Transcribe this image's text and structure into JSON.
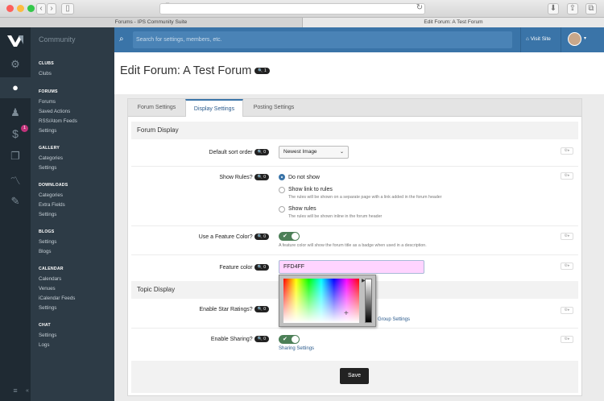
{
  "browser": {
    "tabs": [
      "Forums - IPS Community Suite",
      "Edit Forum: A Test Forum"
    ],
    "traffic_colors": [
      "#fc605c",
      "#fdbc40",
      "#34c84a"
    ]
  },
  "sidebar": {
    "brand": "Community",
    "notification_count": "1",
    "rail_icons": [
      "cogs-icon",
      "comments-icon",
      "user-icon",
      "dollar-icon",
      "copy-icon",
      "chart-icon",
      "brush-icon"
    ],
    "sections": [
      {
        "title": "CLUBS",
        "items": [
          "Clubs"
        ]
      },
      {
        "title": "FORUMS",
        "items": [
          "Forums",
          "Saved Actions",
          "RSS/Atom Feeds",
          "Settings"
        ]
      },
      {
        "title": "GALLERY",
        "items": [
          "Categories",
          "Settings"
        ]
      },
      {
        "title": "DOWNLOADS",
        "items": [
          "Categories",
          "Extra Fields",
          "Settings"
        ]
      },
      {
        "title": "BLOGS",
        "items": [
          "Settings",
          "Blogs"
        ]
      },
      {
        "title": "CALENDAR",
        "items": [
          "Calendars",
          "Venues",
          "iCalendar Feeds",
          "Settings"
        ]
      },
      {
        "title": "CHAT",
        "items": [
          "Settings",
          "Logs"
        ]
      }
    ]
  },
  "header": {
    "search_placeholder": "Search for settings, members, etc.",
    "visit_site": "Visit Site"
  },
  "page": {
    "title": "Edit Forum: A Test Forum",
    "title_badge": "1"
  },
  "tabs": [
    "Forum Settings",
    "Display Settings",
    "Posting Settings"
  ],
  "active_tab": "Display Settings",
  "forum_display": {
    "heading": "Forum Display",
    "sort_order_label": "Default sort order",
    "sort_order_value": "Newest Image",
    "show_rules_label": "Show Rules?",
    "rules_options": [
      {
        "label": "Do not show",
        "desc": ""
      },
      {
        "label": "Show link to rules",
        "desc": "The rules will be shown on a separate page with a link added in the forum header"
      },
      {
        "label": "Show rules",
        "desc": "The rules will be shown inline in the forum header"
      }
    ],
    "feature_color_toggle_label": "Use a Feature Color?",
    "feature_color_desc": "A feature color will show the forum title as a badge when used in a description.",
    "feature_color_label": "Feature color",
    "feature_color_value": "FFD4FF"
  },
  "topic_display": {
    "heading": "Topic Display",
    "star_ratings_label": "Enable Star Ratings?",
    "group_settings_link": "Group Settings",
    "sharing_label": "Enable Sharing?",
    "sharing_settings_link": "Sharing Settings"
  },
  "badges": {
    "zero": "0"
  },
  "save_label": "Save"
}
